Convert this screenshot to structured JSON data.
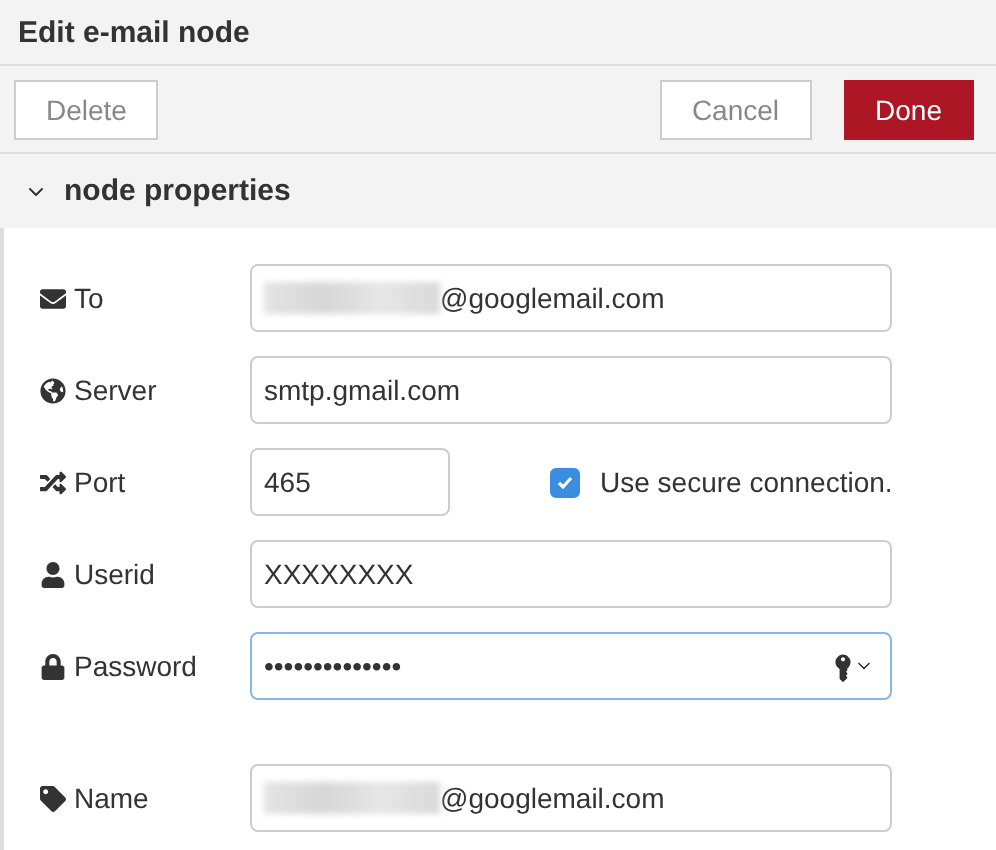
{
  "window": {
    "title": "Edit e-mail node"
  },
  "buttons": [
    {
      "label": "Delete",
      "kind": "plain"
    },
    {
      "label": "Cancel",
      "kind": "plain"
    },
    {
      "label": "Done",
      "kind": "primary"
    }
  ],
  "section": {
    "label": "node properties",
    "expanded": true
  },
  "fields": [
    {
      "label": "To",
      "kind": "text",
      "value": "@googlemail.com",
      "redacted": true
    },
    {
      "label": "Server",
      "kind": "text",
      "value": "smtp.gmail.com",
      "redacted": false
    },
    {
      "label": "Port",
      "kind": "port",
      "value": "465",
      "checkbox": {
        "label": "Use secure connection.",
        "checked": true
      }
    },
    {
      "label": "Userid",
      "kind": "text",
      "value": "XXXXXXXX",
      "redacted": false
    },
    {
      "label": "Password",
      "kind": "password",
      "value": "••••••••••••••",
      "focused": true
    }
  ],
  "name_field": {
    "label": "Name",
    "kind": "text",
    "value": "@googlemail.com",
    "redacted": true
  }
}
